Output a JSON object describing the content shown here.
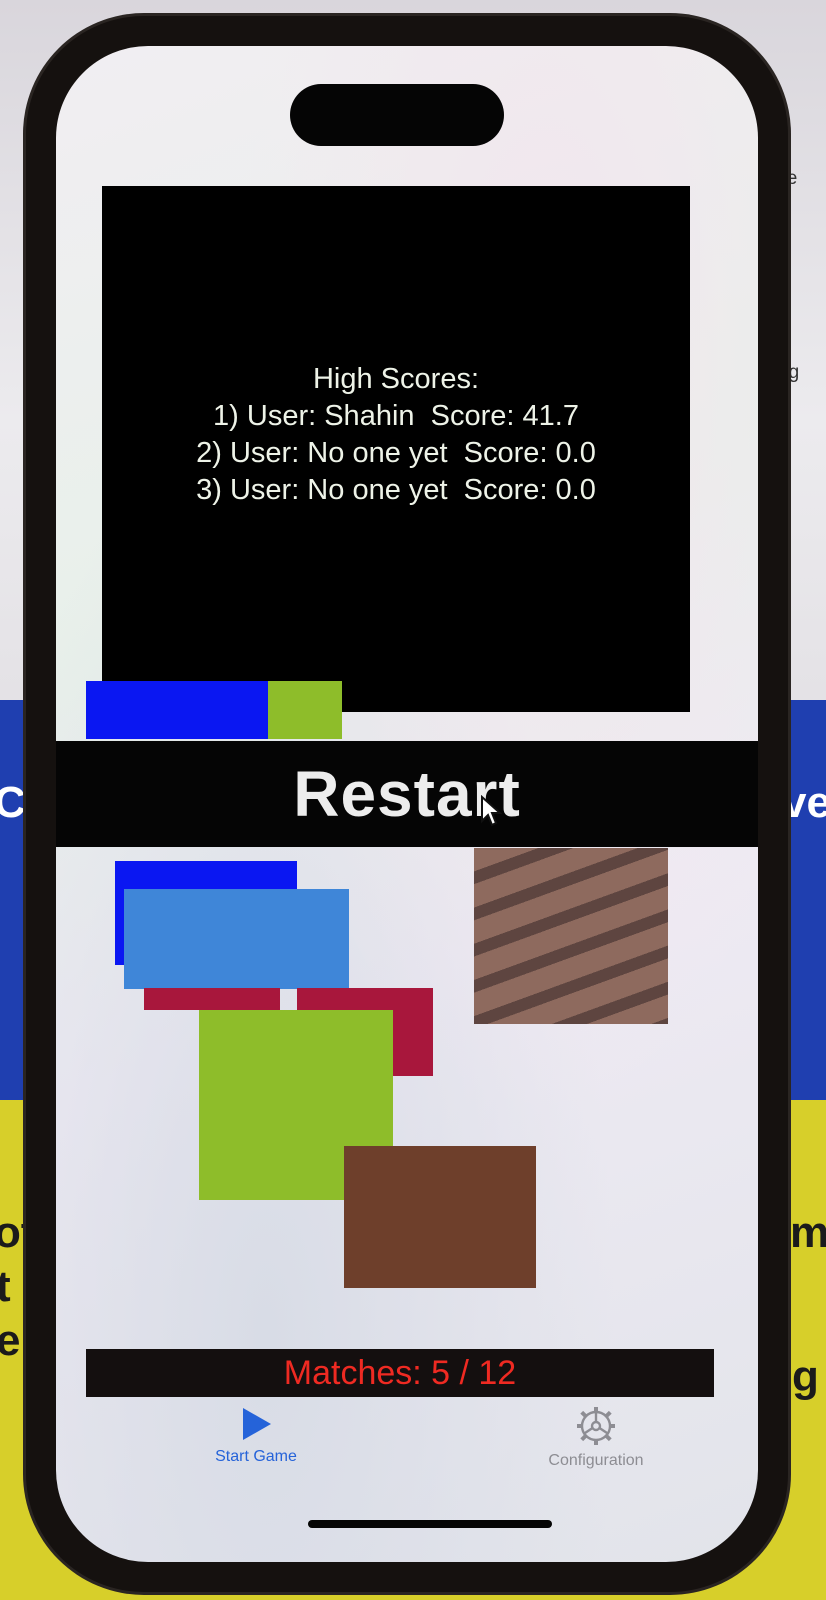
{
  "background": {
    "fragments": [
      "gle",
      "eg",
      "Co",
      "ve",
      "ot",
      "t",
      "e",
      "m",
      "g"
    ]
  },
  "high_scores": {
    "title": "High Scores:",
    "entries": [
      "1) User: Shahin  Score: 41.7",
      "2) User: No one yet  Score: 0.0",
      "3) User: No one yet  Score: 0.0"
    ]
  },
  "restart": {
    "label": "Restart"
  },
  "cards": {
    "colors": {
      "blue": "#0a17f2",
      "light_blue": "#3f86d8",
      "crimson": "#a8173c",
      "green": "#8ebd2a",
      "brown_texture": "#8e6a5e",
      "brown": "#6e3f2b"
    }
  },
  "matches": {
    "label": "Matches:  5 / 12"
  },
  "tabbar": {
    "start": {
      "label": "Start Game",
      "icon": "play-icon",
      "color": "#2563d9"
    },
    "config": {
      "label": "Configuration",
      "icon": "gear-icon",
      "color": "#8d8d93"
    }
  }
}
